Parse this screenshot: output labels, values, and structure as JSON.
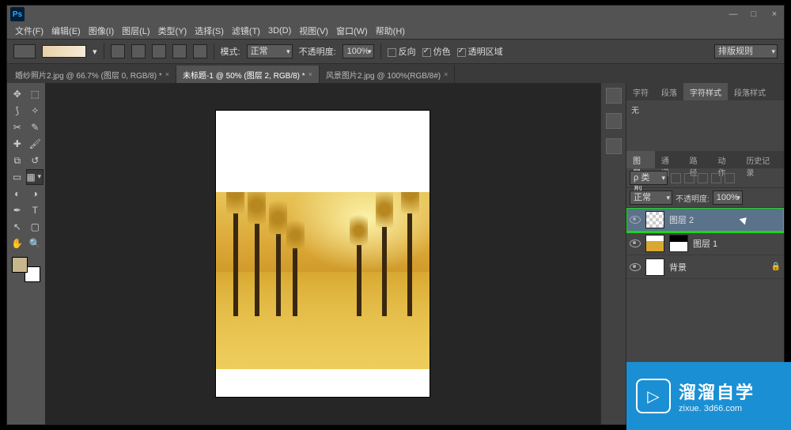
{
  "app": {
    "logo": "Ps"
  },
  "menu": {
    "file": "文件(F)",
    "edit": "编辑(E)",
    "image": "图像(I)",
    "layer": "图层(L)",
    "type": "类型(Y)",
    "select": "选择(S)",
    "filter": "滤镜(T)",
    "threeD": "3D(D)",
    "view": "视图(V)",
    "window": "窗口(W)",
    "help": "帮助(H)"
  },
  "options": {
    "mode_label": "模式:",
    "mode_value": "正常",
    "opacity_label": "不透明度:",
    "opacity_value": "100%",
    "reverse": "反向",
    "dither": "仿色",
    "transparency": "透明区域",
    "arrange": "排版规则"
  },
  "tabs": [
    {
      "label": "婚纱照片2.jpg @ 66.7% (图层 0, RGB/8) *"
    },
    {
      "label": "未标题-1 @ 50% (图层 2, RGB/8) *"
    },
    {
      "label": "风景图片2.jpg @ 100%(RGB/8#)"
    }
  ],
  "charPanel": {
    "tabs": {
      "char": "字符",
      "para": "段落",
      "charStyle": "字符样式",
      "paraStyle": "段落样式"
    },
    "value": "无"
  },
  "layerPanel": {
    "tabs": {
      "layers": "图层",
      "channels": "通道",
      "paths": "路径",
      "actions": "动作",
      "history": "历史记录"
    },
    "kind": "ρ 类型",
    "blend": "正常",
    "opacity_label": "不透明度:",
    "opacity_value": "100%",
    "layers": [
      {
        "name": "图层 2",
        "hl": true,
        "thumb": "checker"
      },
      {
        "name": "图层 1",
        "thumb": "photo",
        "mask": true
      },
      {
        "name": "背景",
        "thumb": "white",
        "lock": true
      }
    ]
  },
  "watermark": {
    "main": "溜溜自学",
    "sub": "zixue. 3d66.com"
  }
}
